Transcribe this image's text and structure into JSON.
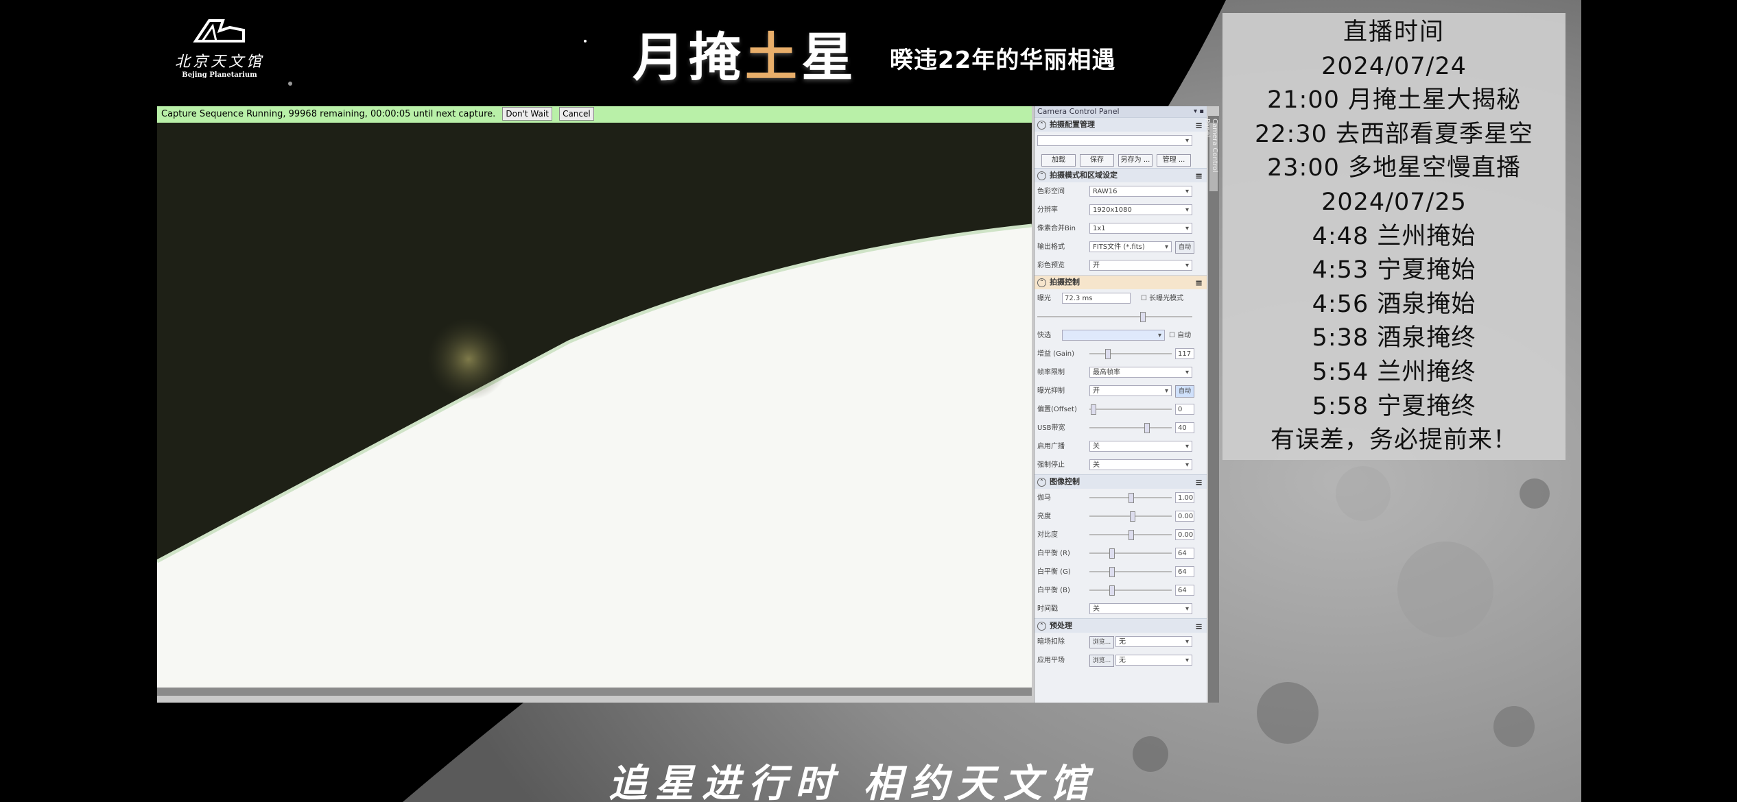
{
  "logo": {
    "cn": "北京天文馆",
    "en": "Bejing Planetarium"
  },
  "title": {
    "part1": "月掩",
    "highlight": "土",
    "part2": "星"
  },
  "subtitle": "暌违22年的华丽相遇",
  "capture_bar": {
    "text": "Capture Sequence Running, 99968 remaining, 00:00:05 until next capture.",
    "dont_wait": "Don't Wait",
    "cancel": "Cancel"
  },
  "camera_panel": {
    "title": "Camera Control Panel",
    "vertical_tab": "Camera Control Panel",
    "profile_section": "拍摄配置管理",
    "profile_buttons": [
      "加载",
      "保存",
      "另存为 ...",
      "管理 ..."
    ],
    "mode_section": "拍摄模式和区域设定",
    "mode_rows": [
      {
        "label": "色彩空间",
        "value": "RAW16"
      },
      {
        "label": "分辨率",
        "value": "1920x1080"
      },
      {
        "label": "像素合并Bin",
        "value": "1x1"
      },
      {
        "label": "输出格式",
        "value": "FITS文件 (*.fits)",
        "button": "自动"
      },
      {
        "label": "彩色预览",
        "value": "开"
      }
    ],
    "capture_section": "拍摄控制",
    "exposure_label": "曝光",
    "exposure_value": "72.3 ms",
    "long_exposure": "长曝光模式",
    "quick_label": "快选",
    "quick_auto": "自动",
    "capture_rows": [
      {
        "label": "增益 (Gain)",
        "type": "slider",
        "value": "117",
        "pos": 0.2
      },
      {
        "label": "帧率限制",
        "type": "select",
        "value": "最高帧率"
      },
      {
        "label": "曝光抑制",
        "type": "select",
        "value": "开",
        "button": "自动"
      },
      {
        "label": "偏置(Offset)",
        "type": "slider",
        "value": "0",
        "pos": 0.02
      },
      {
        "label": "USB带宽",
        "type": "slider",
        "value": "40",
        "pos": 0.7
      },
      {
        "label": "启用广播",
        "type": "select",
        "value": "关"
      },
      {
        "label": "强制停止",
        "type": "select",
        "value": "关"
      }
    ],
    "image_section": "图像控制",
    "image_rows": [
      {
        "label": "伽马",
        "value": "1.00",
        "pos": 0.5
      },
      {
        "label": "亮度",
        "value": "0.00",
        "pos": 0.52
      },
      {
        "label": "对比度",
        "value": "0.00",
        "pos": 0.5
      },
      {
        "label": "白平衡 (R)",
        "value": "64",
        "pos": 0.25
      },
      {
        "label": "白平衡 (G)",
        "value": "64",
        "pos": 0.25
      },
      {
        "label": "白平衡 (B)",
        "value": "64",
        "pos": 0.25
      }
    ],
    "time_label": "时间戳",
    "time_value": "关",
    "pre_section": "预处理",
    "pre_rows": [
      {
        "label": "暗场扣除",
        "button": "浏览...",
        "value": "无"
      },
      {
        "label": "应用平场",
        "button": "浏览...",
        "value": "无"
      }
    ]
  },
  "schedule": {
    "heading": "直播时间",
    "lines": [
      "2024/07/24",
      "21:00 月掩土星大揭秘",
      "22:30 去西部看夏季星空",
      "23:00 多地星空慢直播",
      "2024/07/25",
      "4:48 兰州掩始",
      "4:53 宁夏掩始",
      "4:56 酒泉掩始",
      "5:38 酒泉掩终",
      "5:54 兰州掩终",
      "5:58 宁夏掩终",
      "有误差，务必提前来！"
    ]
  },
  "bottom_slogan": "追星进行时 相约天文馆",
  "colors": {
    "capture_bar": "#b9f0a8",
    "title_highlight": "#e8ae6a",
    "schedule_bg": "#cdcdcd"
  }
}
